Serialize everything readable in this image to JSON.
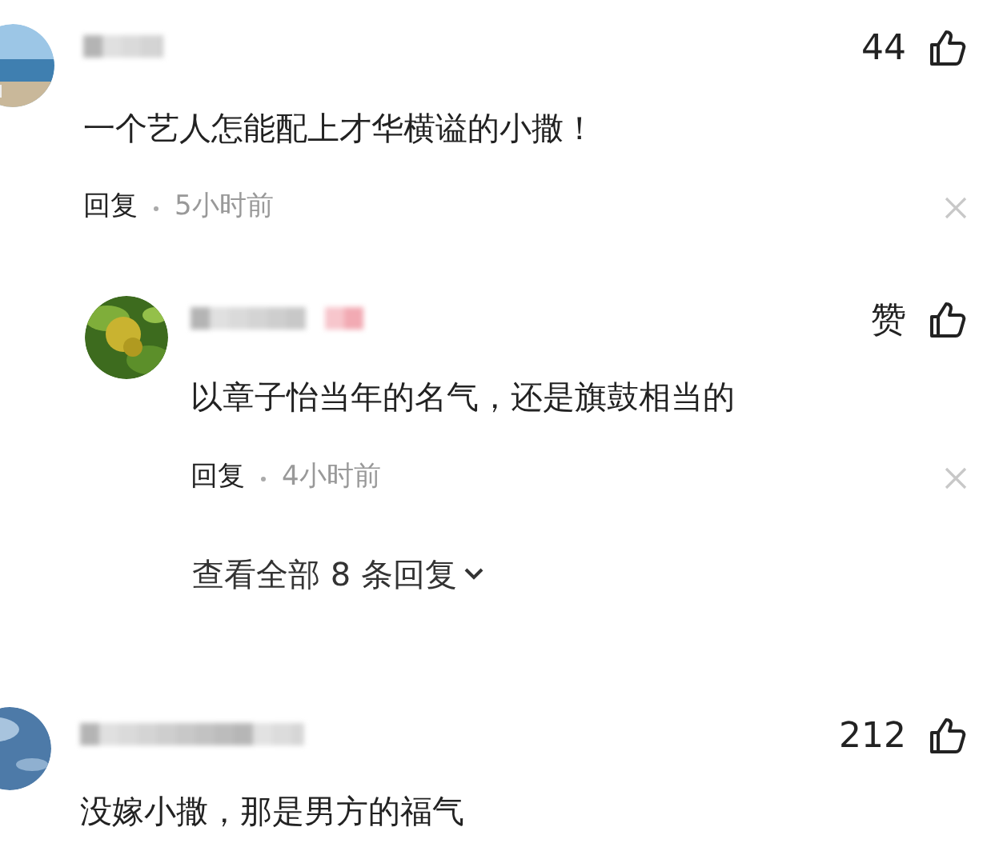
{
  "comments": [
    {
      "likes": "44",
      "text": "一个艺人怎能配上才华横谥的小撒！",
      "reply_label": "回复",
      "time": "5小时前",
      "children": [
        {
          "likes": "赞",
          "text": "以章子怡当年的名气，还是旗鼓相当的",
          "reply_label": "回复",
          "time": "4小时前"
        }
      ],
      "view_more": "查看全部 8 条回复"
    },
    {
      "likes": "212",
      "text": "没嫁小撒，那是男方的福气"
    }
  ]
}
